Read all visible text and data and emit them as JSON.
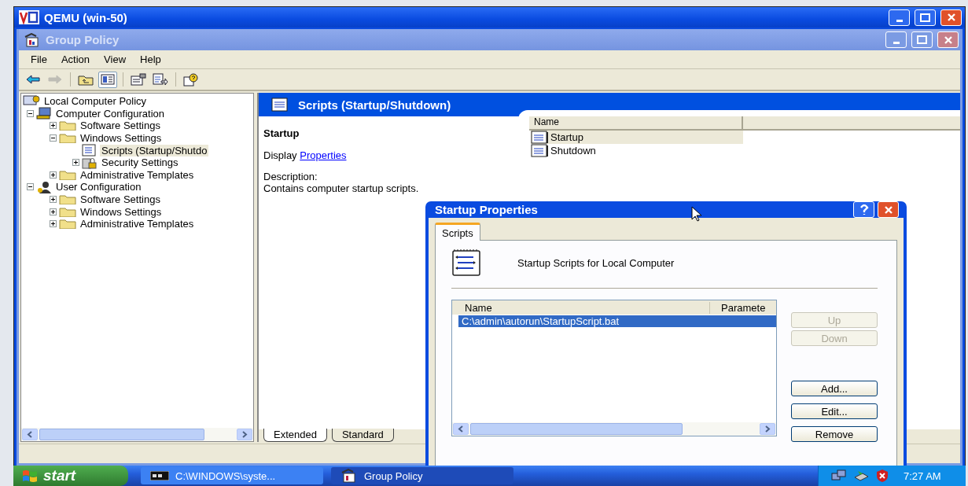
{
  "qemu": {
    "title": "QEMU (win-50)"
  },
  "gp_window": {
    "title": "Group Policy",
    "active": false
  },
  "menu": [
    "File",
    "Action",
    "View",
    "Help"
  ],
  "toolbar": [
    {
      "kind": "back",
      "disabled": false,
      "pressed": false
    },
    {
      "kind": "forward",
      "disabled": true,
      "pressed": false
    },
    {
      "kind": "up-folder",
      "disabled": false,
      "pressed": false
    },
    {
      "kind": "tree-toggle",
      "disabled": false,
      "pressed": true
    },
    {
      "kind": "properties",
      "disabled": false,
      "pressed": false
    },
    {
      "kind": "export",
      "disabled": false,
      "pressed": false
    },
    {
      "kind": "help",
      "disabled": false,
      "pressed": false
    }
  ],
  "tree": [
    {
      "label": "Local Computer Policy",
      "kind": "policy",
      "expanded": true,
      "selected": false,
      "children": [
        {
          "label": "Computer Configuration",
          "kind": "computer",
          "expanded": true,
          "selected": false,
          "children": [
            {
              "label": "Software Settings",
              "kind": "folder",
              "expanded": false,
              "selected": false
            },
            {
              "label": "Windows Settings",
              "kind": "folder",
              "expanded": true,
              "selected": false,
              "children": [
                {
                  "label": "Scripts (Startup/Shutdo",
                  "kind": "script",
                  "selected": true
                },
                {
                  "label": "Security Settings",
                  "kind": "security",
                  "expanded": false,
                  "selected": false
                }
              ]
            },
            {
              "label": "Administrative Templates",
              "kind": "folder",
              "expanded": false,
              "selected": false
            }
          ]
        },
        {
          "label": "User Configuration",
          "kind": "user",
          "expanded": true,
          "selected": false,
          "children": [
            {
              "label": "Software Settings",
              "kind": "folder",
              "expanded": false,
              "selected": false
            },
            {
              "label": "Windows Settings",
              "kind": "folder",
              "expanded": false,
              "selected": false
            },
            {
              "label": "Administrative Templates",
              "kind": "folder",
              "expanded": false,
              "selected": false
            }
          ]
        }
      ]
    }
  ],
  "detail": {
    "title": "Scripts (Startup/Shutdown)",
    "heading": "Startup",
    "display_text": "Display",
    "link": "Properties",
    "description_label": "Description:",
    "description": "Contains computer startup scripts."
  },
  "list": {
    "columns": [
      "Name"
    ],
    "rows": [
      {
        "name": "Startup",
        "selected": true
      },
      {
        "name": "Shutdown",
        "selected": false
      }
    ]
  },
  "view_tabs": [
    {
      "label": "Extended",
      "selected": true
    },
    {
      "label": "Standard",
      "selected": false
    }
  ],
  "dialog": {
    "title": "Startup Properties",
    "tabs": [
      {
        "label": "Scripts",
        "selected": true
      }
    ],
    "heading": "Startup Scripts for Local Computer",
    "columns": [
      "Name",
      "Paramete"
    ],
    "rows": [
      {
        "name": "C:\\admin\\autorun\\StartupScript.bat",
        "selected": true
      }
    ],
    "buttons": [
      {
        "label": "Up",
        "disabled": true
      },
      {
        "label": "Down",
        "disabled": true
      },
      {
        "label": "Add...",
        "disabled": false
      },
      {
        "label": "Edit...",
        "disabled": false
      },
      {
        "label": "Remove",
        "disabled": false
      }
    ]
  },
  "taskbar": {
    "start": "start",
    "tasks": [
      {
        "label": "C:\\WINDOWS\\syste...",
        "kind": "console",
        "selected": false
      },
      {
        "label": "Group Policy",
        "kind": "policy",
        "selected": true
      }
    ],
    "clock": "7:27 AM"
  }
}
